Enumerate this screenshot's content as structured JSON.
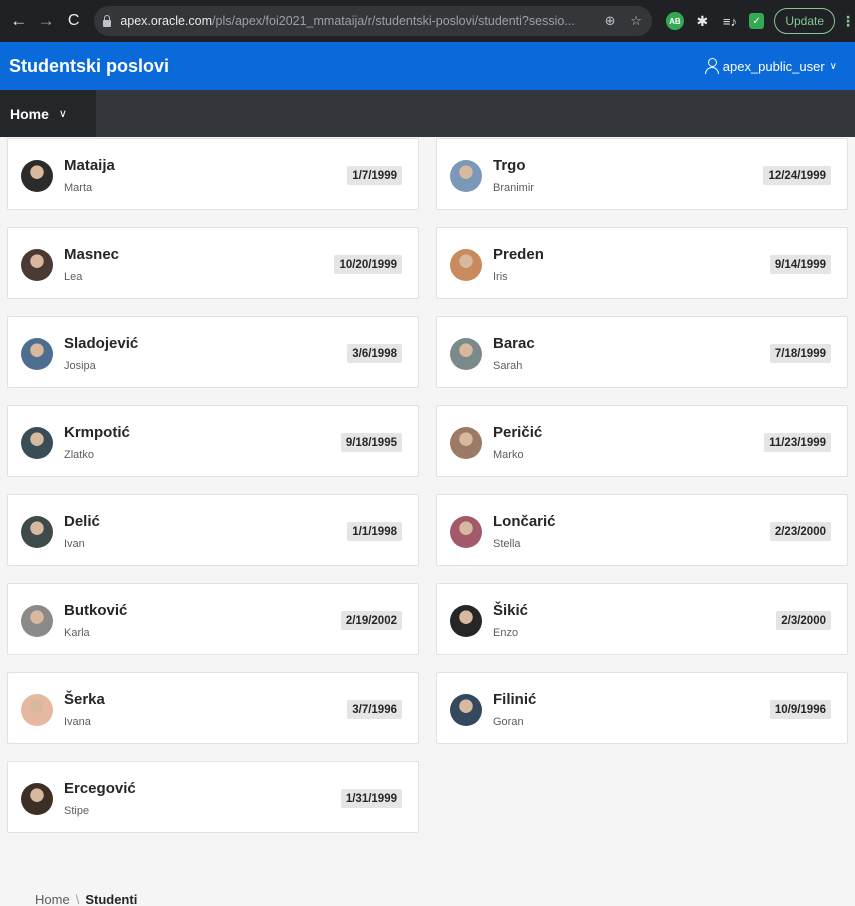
{
  "browser": {
    "back_icon": "←",
    "forward_icon": "→",
    "reload_icon": "C",
    "url_host": "apex.oracle.com",
    "url_path": "/pls/apex/foi2021_mmataija/r/studentski-poslovi/studenti?sessio...",
    "zoom_icon": "⊕",
    "star_icon": "☆",
    "ext_ab_label": "AB",
    "ext_puzzle_icon": "✱",
    "ext_queue_icon": "≡♪",
    "ext_check_icon": "✓",
    "update_label": "Update",
    "menu_icon": "⋮"
  },
  "app": {
    "title": "Studentski poslovi",
    "user": "apex_public_user",
    "user_chevron": "∨"
  },
  "menu": {
    "home_label": "Home",
    "home_chevron": "∨"
  },
  "students": [
    {
      "surname": "Mataija",
      "name": "Marta",
      "date": "1/7/1999",
      "avatar_color": "#2b2b2b"
    },
    {
      "surname": "Trgo",
      "name": "Branimir",
      "date": "12/24/1999",
      "avatar_color": "#7b98b8"
    },
    {
      "surname": "Masnec",
      "name": "Lea",
      "date": "10/20/1999",
      "avatar_color": "#4a3a33"
    },
    {
      "surname": "Preden",
      "name": "Iris",
      "date": "9/14/1999",
      "avatar_color": "#c98a5e"
    },
    {
      "surname": "Sladojević",
      "name": "Josipa",
      "date": "3/6/1998",
      "avatar_color": "#4d6e8f"
    },
    {
      "surname": "Barac",
      "name": "Sarah",
      "date": "7/18/1999",
      "avatar_color": "#7a8a8a"
    },
    {
      "surname": "Krmpotić",
      "name": "Zlatko",
      "date": "9/18/1995",
      "avatar_color": "#3a4c57"
    },
    {
      "surname": "Peričić",
      "name": "Marko",
      "date": "11/23/1999",
      "avatar_color": "#9c7b66"
    },
    {
      "surname": "Delić",
      "name": "Ivan",
      "date": "1/1/1998",
      "avatar_color": "#3f4a4a"
    },
    {
      "surname": "Lončarić",
      "name": "Stella",
      "date": "2/23/2000",
      "avatar_color": "#a25a6a"
    },
    {
      "surname": "Butković",
      "name": "Karla",
      "date": "2/19/2002",
      "avatar_color": "#8a8a8a"
    },
    {
      "surname": "Šikić",
      "name": "Enzo",
      "date": "2/3/2000",
      "avatar_color": "#262626"
    },
    {
      "surname": "Šerka",
      "name": "Ivana",
      "date": "3/7/1996",
      "avatar_color": "#e6b8a0"
    },
    {
      "surname": "Filinić",
      "name": "Goran",
      "date": "10/9/1996",
      "avatar_color": "#34495e"
    },
    {
      "surname": "Ercegović",
      "name": "Stipe",
      "date": "1/31/1999",
      "avatar_color": "#3d2f26"
    }
  ],
  "breadcrumb": {
    "home": "Home",
    "separator": "\\",
    "current": "Studenti"
  }
}
